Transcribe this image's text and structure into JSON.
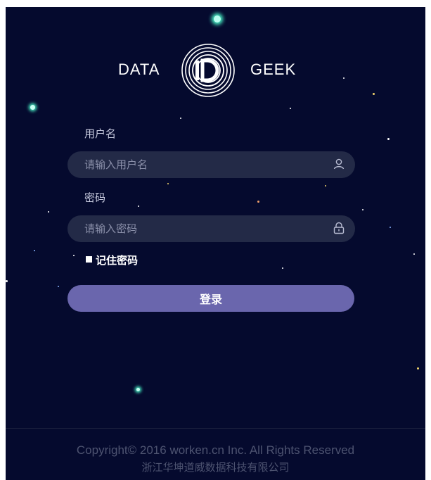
{
  "logo": {
    "left_text": "DATA",
    "right_text": "GEEK",
    "mark_icon": "concentric-circles-d-logo-icon"
  },
  "form": {
    "username_label": "用户名",
    "username_placeholder": "请输入用户名",
    "username_icon": "user-icon",
    "password_label": "密码",
    "password_placeholder": "请输入密码",
    "password_icon": "lock-icon",
    "remember_label": "记住密码",
    "login_button": "登录"
  },
  "footer": {
    "copyright": "Copyright© 2016 worken.cn Inc. All Rights Reserved",
    "company": "浙江华坤道威数据科技有限公司"
  },
  "colors": {
    "background": "#050a2e",
    "input_bg": "#232a47",
    "button": "#6a66ad",
    "star_glow": "#7dffd6",
    "star_warm": "#f2d46b"
  }
}
